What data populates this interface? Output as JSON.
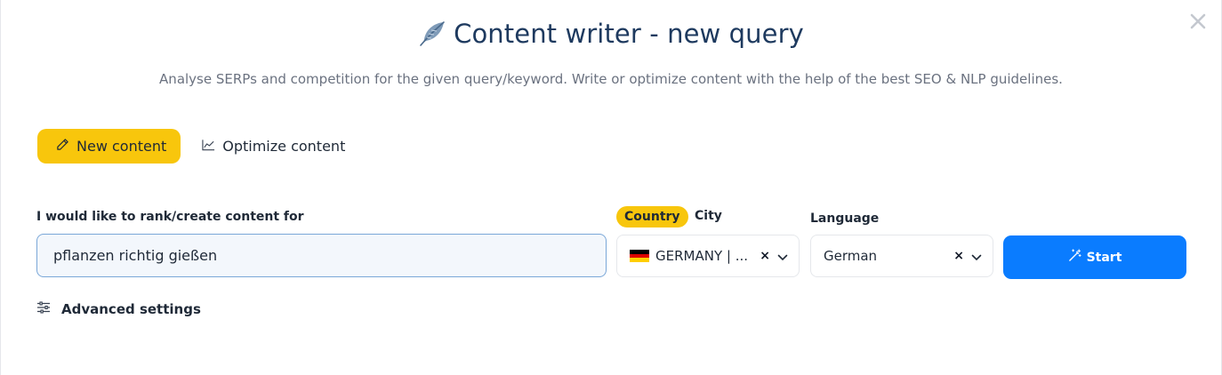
{
  "dialog": {
    "title": "Content writer - new query",
    "subtitle": "Analyse SERPs and competition for the given query/keyword. Write or optimize content with the help of the best SEO & NLP guidelines."
  },
  "mode_tabs": [
    {
      "label": "New content",
      "icon": "pencil-icon",
      "active": true
    },
    {
      "label": "Optimize content",
      "icon": "chart-icon",
      "active": false
    }
  ],
  "query": {
    "label": "I would like to rank/create content for",
    "value": "pflanzen richtig gießen"
  },
  "location": {
    "country_tab": "Country",
    "city_tab": "City",
    "selected": "GERMANY | ...",
    "clear": "×"
  },
  "language": {
    "label": "Language",
    "selected": "German",
    "clear": "×"
  },
  "start_button": {
    "label": "Start",
    "color": "#0a7cff"
  },
  "advanced": {
    "label": "Advanced settings"
  },
  "colors": {
    "accent_yellow": "#f8c60c",
    "title": "#1e3a5f"
  }
}
